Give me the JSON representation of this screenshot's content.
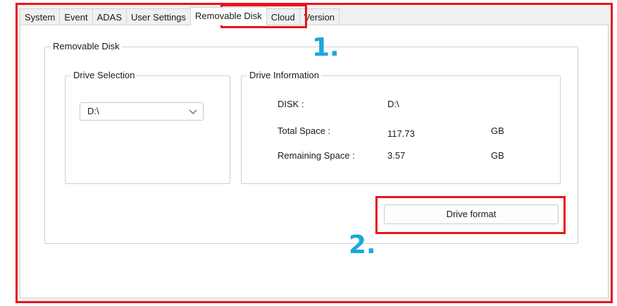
{
  "tabs": [
    {
      "label": "System"
    },
    {
      "label": "Event"
    },
    {
      "label": "ADAS"
    },
    {
      "label": "User Settings"
    },
    {
      "label": "Removable Disk",
      "active": true
    },
    {
      "label": "Cloud"
    },
    {
      "label": "Version"
    }
  ],
  "removable_disk": {
    "title": "Removable Disk",
    "drive_selection": {
      "title": "Drive Selection",
      "selected_drive": "D:\\"
    },
    "drive_information": {
      "title": "Drive Information",
      "disk_label": "DISK :",
      "disk_value": "D:\\",
      "total_label": "Total Space :",
      "total_value": "117.73",
      "total_unit": "GB",
      "remaining_label": "Remaining Space :",
      "remaining_value": "3.57",
      "remaining_unit": "GB"
    },
    "format_button_label": "Drive format"
  },
  "annotations": {
    "step1": "1.",
    "step2": "2.",
    "highlight_color": "#e8141c",
    "step_color": "#1aa7e0"
  }
}
